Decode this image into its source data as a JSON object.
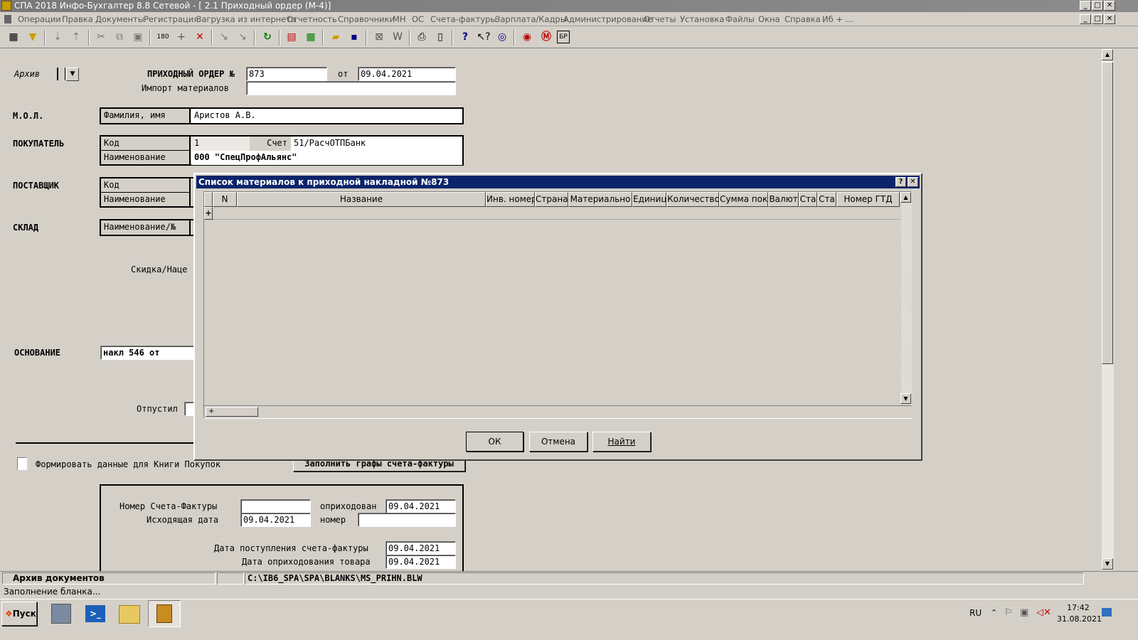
{
  "window": {
    "title": "СПА 2018 Инфо-Бухгалтер 8.8 Сетевой - [ 2.1 Приходный ордер (М-4)]",
    "controls": [
      "_",
      "□",
      "✕"
    ]
  },
  "menu": {
    "items": [
      "Операции",
      "Правка",
      "Документы",
      "Регистрация",
      "Загрузка из интернета",
      "Отчетность",
      "Справочники",
      "МН",
      "ОС",
      "Счета-фактуры",
      "Зарплата/Кадры",
      "Администрирование",
      "Отчеты",
      "Установка",
      "Файлы",
      "Окна",
      "Справка",
      "Иб + ..."
    ]
  },
  "form": {
    "archive_label": "Архив",
    "order_label": "ПРИХОДНЫЙ ОРДЕР №",
    "order_number": "873",
    "from_label": "от",
    "order_date": "09.04.2021",
    "import_label": "Импорт материалов",
    "import_value": "",
    "mol_label": "М.О.Л.",
    "mol_field_label": "Фамилия, имя",
    "mol_value": "Аристов А.В.",
    "buyer_label": "ПОКУПАТЕЛЬ",
    "code_label": "Код",
    "buyer_code": "1",
    "account_label": "Счет",
    "buyer_account": "51/РасчОТПБанк",
    "name_label": "Наименование",
    "buyer_name": "000 \"СпецПрофАльянс\"",
    "supplier_label": "ПОСТАВЩИК",
    "supplier_code_label": "Код",
    "supplier_name_label": "Наименование",
    "warehouse_label": "СКЛАД",
    "warehouse_field_label": "Наименование/№",
    "discount_label": "Скидка/Наце",
    "basis_label": "ОСНОВАНИЕ",
    "basis_value": "накл 546     от",
    "released_label": "Отпустил",
    "purchase_book_label": "Формировать данные для Книги Покупок",
    "fill_invoice_button": "Заполнить графы счета-фактуры",
    "invoice_number_label": "Номер Счета-Фактуры",
    "invoice_number": "",
    "posted_label": "оприходован",
    "posted_date": "09.04.2021",
    "outgoing_date_label": "Исходящая дата",
    "outgoing_date": "09.04.2021",
    "number_label": "номер",
    "number_value": "",
    "invoice_receipt_label": "Дата поступления счета-фактуры",
    "invoice_receipt_date": "09.04.2021",
    "goods_posting_label": "Дата оприходования товара",
    "goods_posting_date": "09.04.2021"
  },
  "dialog": {
    "title": "Список материалов к приходной накладной №873",
    "help": "?",
    "close": "✕",
    "columns": [
      "N",
      "Название",
      "Инв. номер",
      "Страна",
      "Материально",
      "Единиц",
      "Количество",
      "Сумма поку",
      "Валют",
      "Ста",
      "Ста",
      "Номер ГТД"
    ],
    "row_marker": "+",
    "footer_marker": "+",
    "ok": "ОК",
    "cancel": "Отмена",
    "find": "Найти"
  },
  "status": {
    "left": "Архив документов",
    "path": "C:\\IB6_SPA\\SPA\\BLANKS\\MS_PRIHN.BLW",
    "message": "Заполнение бланка..."
  },
  "taskbar": {
    "start": "Пуск",
    "lang": "RU",
    "time": "17:42",
    "date": "31.08.2021"
  }
}
